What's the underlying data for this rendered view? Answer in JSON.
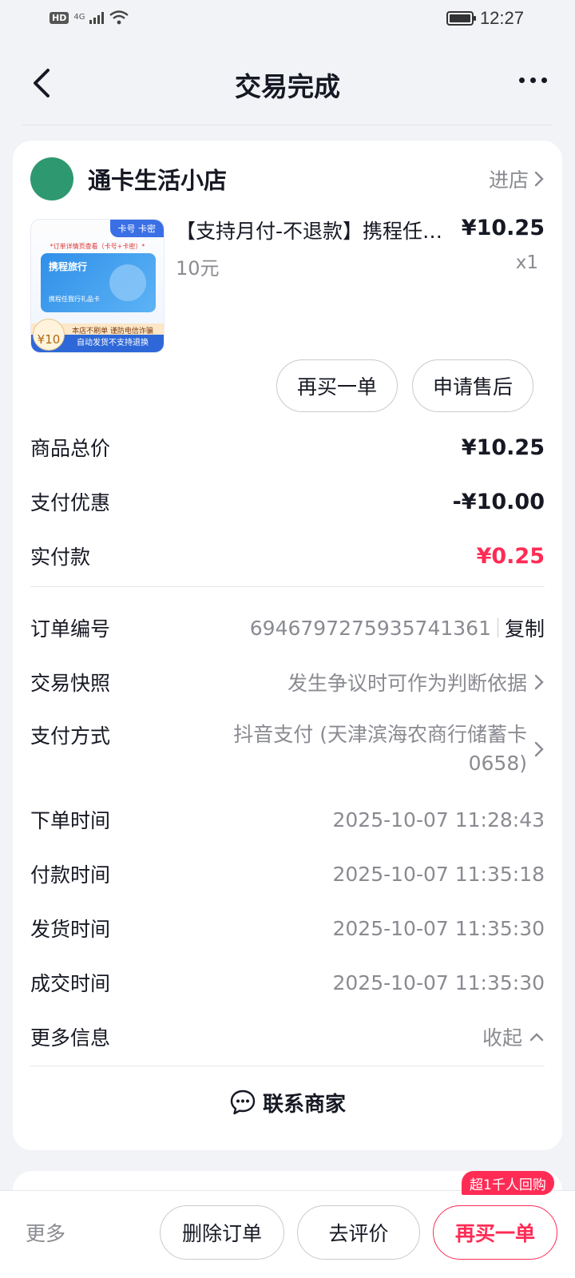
{
  "status_bar": {
    "hd": "HD",
    "network": "4G",
    "time": "12:27"
  },
  "header": {
    "title": "交易完成"
  },
  "shop": {
    "name": "通卡生活小店",
    "enter_label": "进店"
  },
  "product": {
    "title": "【支持月付-不退款】携程任…",
    "spec": "10元",
    "price": "¥10.25",
    "qty": "x1",
    "thumb": {
      "tag": "卡号 卡密",
      "note": "*订单详情页查看（卡号+卡密）*",
      "brand": "携程旅行",
      "sub": "携程任我行礼品卡",
      "warn": "本店不刷单 谨防电信诈骗",
      "foot": "自动发货不支持退换",
      "badge": "¥10"
    }
  },
  "actions": {
    "rebuy": "再买一单",
    "aftersale": "申请售后"
  },
  "prices": [
    {
      "label": "商品总价",
      "value": "¥10.25",
      "red": false
    },
    {
      "label": "支付优惠",
      "value": "-¥10.00",
      "red": false
    },
    {
      "label": "实付款",
      "value": "¥0.25",
      "red": true
    }
  ],
  "order_info": {
    "order_no_label": "订单编号",
    "order_no": "6946797275935741361",
    "copy_label": "复制",
    "snapshot_label": "交易快照",
    "snapshot_value": "发生争议时可作为判断依据",
    "pay_method_label": "支付方式",
    "pay_method_value": "抖音支付 (天津滨海农商行储蓄卡 0658)",
    "order_time_label": "下单时间",
    "order_time": "2025-10-07 11:28:43",
    "pay_time_label": "付款时间",
    "pay_time": "2025-10-07 11:35:18",
    "ship_time_label": "发货时间",
    "ship_time": "2025-10-07 11:35:30",
    "deal_time_label": "成交时间",
    "deal_time": "2025-10-07 11:35:30",
    "more_info_label": "更多信息",
    "collapse_label": "收起"
  },
  "contact_label": "联系商家",
  "bottom_bar": {
    "more": "更多",
    "delete": "删除订单",
    "review": "去评价",
    "rebuy": "再买一单",
    "rebuy_badge": "超1千人回购"
  },
  "colors": {
    "accent": "#fe2c55",
    "shop_avatar": "#2e9870"
  }
}
